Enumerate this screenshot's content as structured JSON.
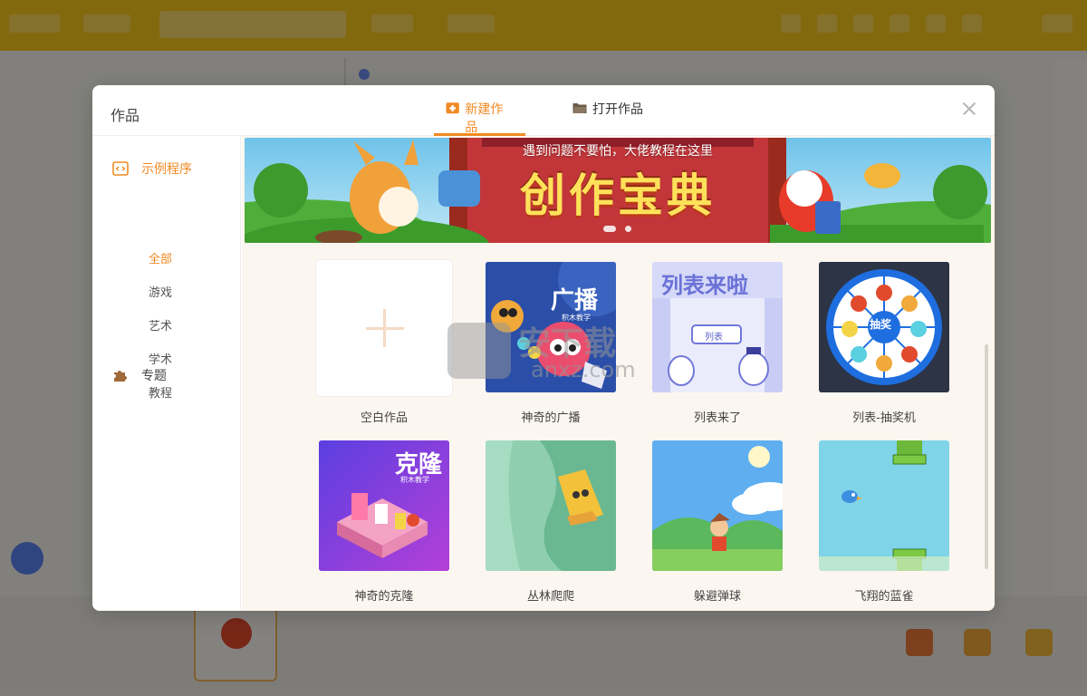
{
  "modal": {
    "title": "作品",
    "tabs": [
      {
        "label": "新建作品",
        "icon": "new-work-icon",
        "active": true
      },
      {
        "label": "打开作品",
        "icon": "folder-icon",
        "active": false
      }
    ],
    "close_icon": "close-icon"
  },
  "sidebar": {
    "categories": [
      {
        "label": "示例程序",
        "icon": "code-window-icon",
        "active": true
      },
      {
        "label": "专题",
        "icon": "puzzle-icon",
        "active": false
      }
    ],
    "subcategories": [
      {
        "label": "全部",
        "active": true
      },
      {
        "label": "游戏",
        "active": false
      },
      {
        "label": "艺术",
        "active": false
      },
      {
        "label": "学术",
        "active": false
      },
      {
        "label": "教程",
        "active": false
      }
    ]
  },
  "banner": {
    "headline": "遇到问题不要怕，大佬教程在这里",
    "title": "创作宝典",
    "active_slide": 1,
    "slide_count": 2
  },
  "projects": [
    {
      "label": "空白作品",
      "type": "blank"
    },
    {
      "label": "神奇的广播",
      "thumb_title": "广播",
      "thumb_sub": "积木教学"
    },
    {
      "label": "列表来了",
      "thumb_title": "列表来啦",
      "thumb_button": "列表"
    },
    {
      "label": "列表-抽奖机",
      "thumb_title": "抽奖"
    },
    {
      "label": "神奇的克隆",
      "thumb_title": "克隆",
      "thumb_sub": "积木教学"
    },
    {
      "label": "丛林爬爬"
    },
    {
      "label": "躲避弹球"
    },
    {
      "label": "飞翔的蓝雀"
    }
  ],
  "watermark": {
    "cn": "安下载",
    "en": "anxz.com"
  },
  "colors": {
    "accent": "#f08a24",
    "topbar": "#f7c71b",
    "content_bg": "#fcf6f0"
  }
}
